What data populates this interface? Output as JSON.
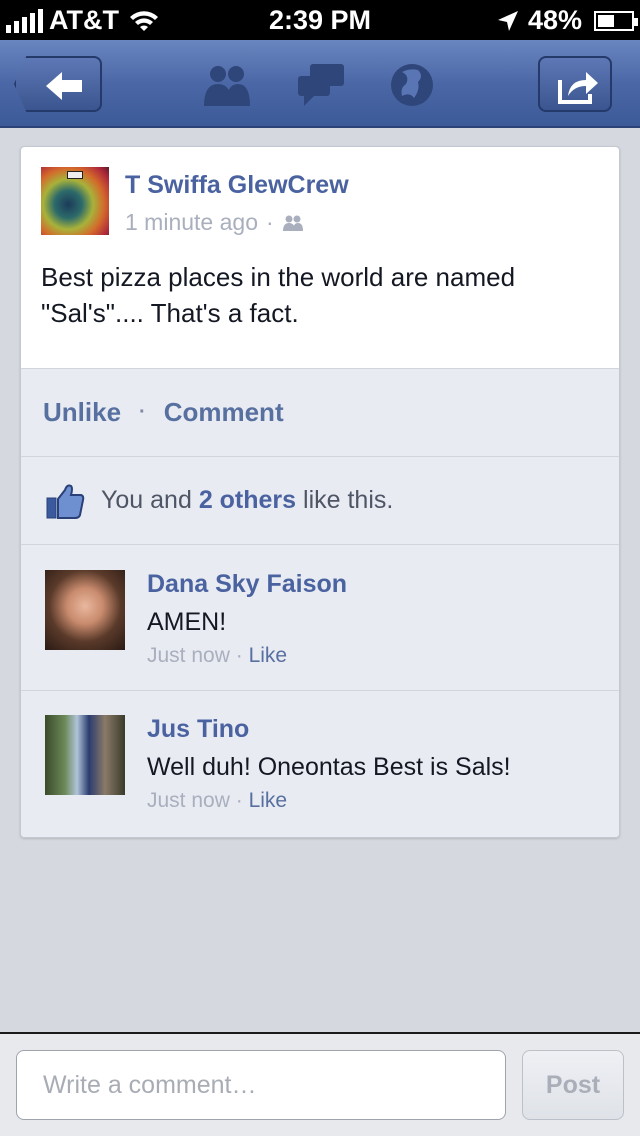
{
  "status_bar": {
    "carrier": "AT&T",
    "time": "2:39 PM",
    "battery": "48%",
    "icons": [
      "signal-icon",
      "wifi-icon",
      "location-arrow-icon",
      "battery-icon"
    ]
  },
  "nav_bar": {
    "icons": [
      "back-arrow-icon",
      "friends-icon",
      "messages-icon",
      "globe-icon",
      "share-icon"
    ]
  },
  "post": {
    "author": "T Swiffa GlewCrew",
    "time": "1 minute ago",
    "separator": "·",
    "text": "Best pizza places in the world are named \"Sal's\".... That's a fact."
  },
  "actions": {
    "unlike": "Unlike",
    "separator": "·",
    "comment": "Comment"
  },
  "likes": {
    "you_and": "You and",
    "others": "2 others",
    "like_this": "like this."
  },
  "comments": [
    {
      "author": "Dana Sky Faison",
      "text": "AMEN!",
      "time": "Just now",
      "separator": "·",
      "like": "Like"
    },
    {
      "author": "Jus Tino",
      "text": "Well duh! Oneontas Best is Sals!",
      "time": "Just now",
      "separator": "·",
      "like": "Like"
    }
  ],
  "composer": {
    "placeholder": "Write a comment…",
    "post_label": "Post"
  },
  "colors": {
    "nav_blue": "#4b67a6",
    "link_blue": "#4a62a0",
    "background": "#d5d8de"
  }
}
